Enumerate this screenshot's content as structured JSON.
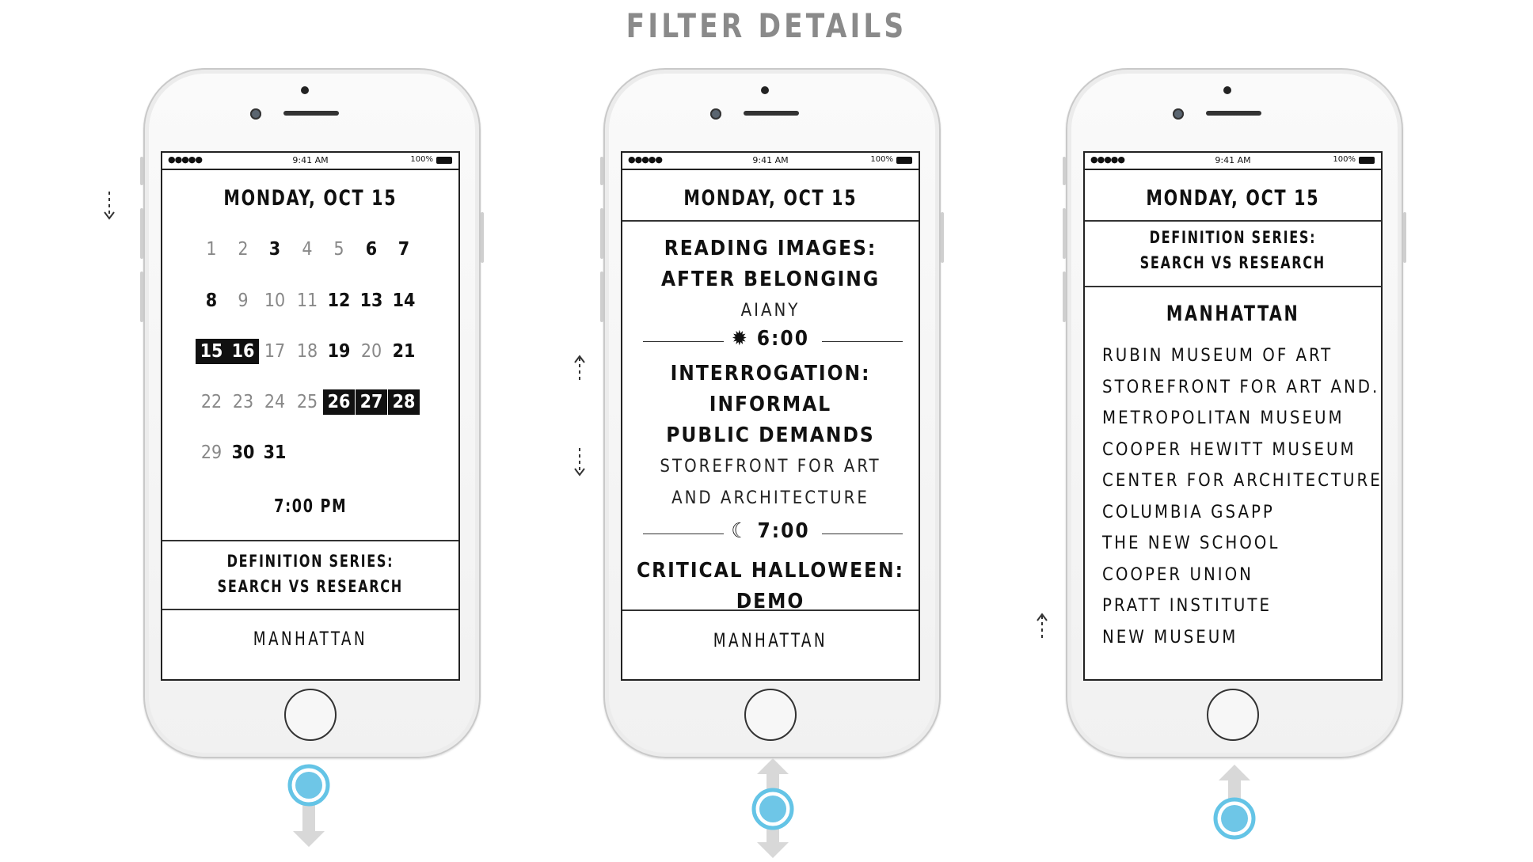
{
  "page_title": "FILTER DETAILS",
  "status_bar": {
    "signal": "●●●●● ",
    "time": "9:41 AM",
    "battery_text": "100%"
  },
  "phone1": {
    "date_header": "MONDAY, OCT 15",
    "calendar": [
      {
        "d": "1",
        "s": "muted"
      },
      {
        "d": "2",
        "s": "muted"
      },
      {
        "d": "3",
        "s": "bold"
      },
      {
        "d": "4",
        "s": "muted"
      },
      {
        "d": "5",
        "s": "muted"
      },
      {
        "d": "6",
        "s": "bold"
      },
      {
        "d": "7",
        "s": "bold"
      },
      {
        "d": "8",
        "s": "bold"
      },
      {
        "d": "9",
        "s": "muted"
      },
      {
        "d": "10",
        "s": "muted"
      },
      {
        "d": "11",
        "s": "muted"
      },
      {
        "d": "12",
        "s": "bold"
      },
      {
        "d": "13",
        "s": "bold"
      },
      {
        "d": "14",
        "s": "bold"
      },
      {
        "d": "15",
        "s": "selected"
      },
      {
        "d": "16",
        "s": "selected"
      },
      {
        "d": "17",
        "s": "muted"
      },
      {
        "d": "18",
        "s": "muted"
      },
      {
        "d": "19",
        "s": "bold"
      },
      {
        "d": "20",
        "s": "muted"
      },
      {
        "d": "21",
        "s": "bold"
      },
      {
        "d": "22",
        "s": "muted"
      },
      {
        "d": "23",
        "s": "muted"
      },
      {
        "d": "24",
        "s": "muted"
      },
      {
        "d": "25",
        "s": "muted"
      },
      {
        "d": "26",
        "s": "selected"
      },
      {
        "d": "27",
        "s": "selected"
      },
      {
        "d": "28",
        "s": "selected"
      },
      {
        "d": "29",
        "s": "muted"
      },
      {
        "d": "30",
        "s": "bold"
      },
      {
        "d": "31",
        "s": "bold"
      }
    ],
    "time": "7:00 PM",
    "series_line1": "DEFINITION SERIES:",
    "series_line2": "SEARCH VS RESEARCH",
    "region": "MANHATTAN"
  },
  "phone2": {
    "date_header": "MONDAY, OCT 15",
    "event1_title_line1": "READING IMAGES:",
    "event1_title_line2": "AFTER BELONGING",
    "event1_venue": "AIANY",
    "time1": "6:00",
    "event2_title_line1": "INTERROGATION: INFORMAL",
    "event2_title_line2": "PUBLIC DEMANDS",
    "event2_venue_line1": "STOREFRONT FOR ART",
    "event2_venue_line2": "AND ARCHITECTURE",
    "time2": "7:00",
    "event3_title_line1": "CRITICAL HALLOWEEN:",
    "event3_title_line2": "DEMO",
    "region": "MANHATTAN"
  },
  "phone3": {
    "date_header": "MONDAY, OCT 15",
    "series_line1": "DEFINITION SERIES:",
    "series_line2": "SEARCH VS RESEARCH",
    "region_title": "MANHATTAN",
    "venues": [
      "RUBIN MUSEUM OF ART",
      "STOREFRONT FOR ART AND...",
      "METROPOLITAN MUSEUM",
      "COOPER HEWITT MUSEUM",
      "CENTER FOR ARCHITECTURE",
      "COLUMBIA GSAPP",
      "THE NEW SCHOOL",
      "COOPER UNION",
      "PRATT INSTITUTE",
      "NEW MUSEUM"
    ]
  },
  "colors": {
    "touch": "#6ec6e7",
    "arrow": "#d5d5d5",
    "title": "#8a8a8a"
  }
}
